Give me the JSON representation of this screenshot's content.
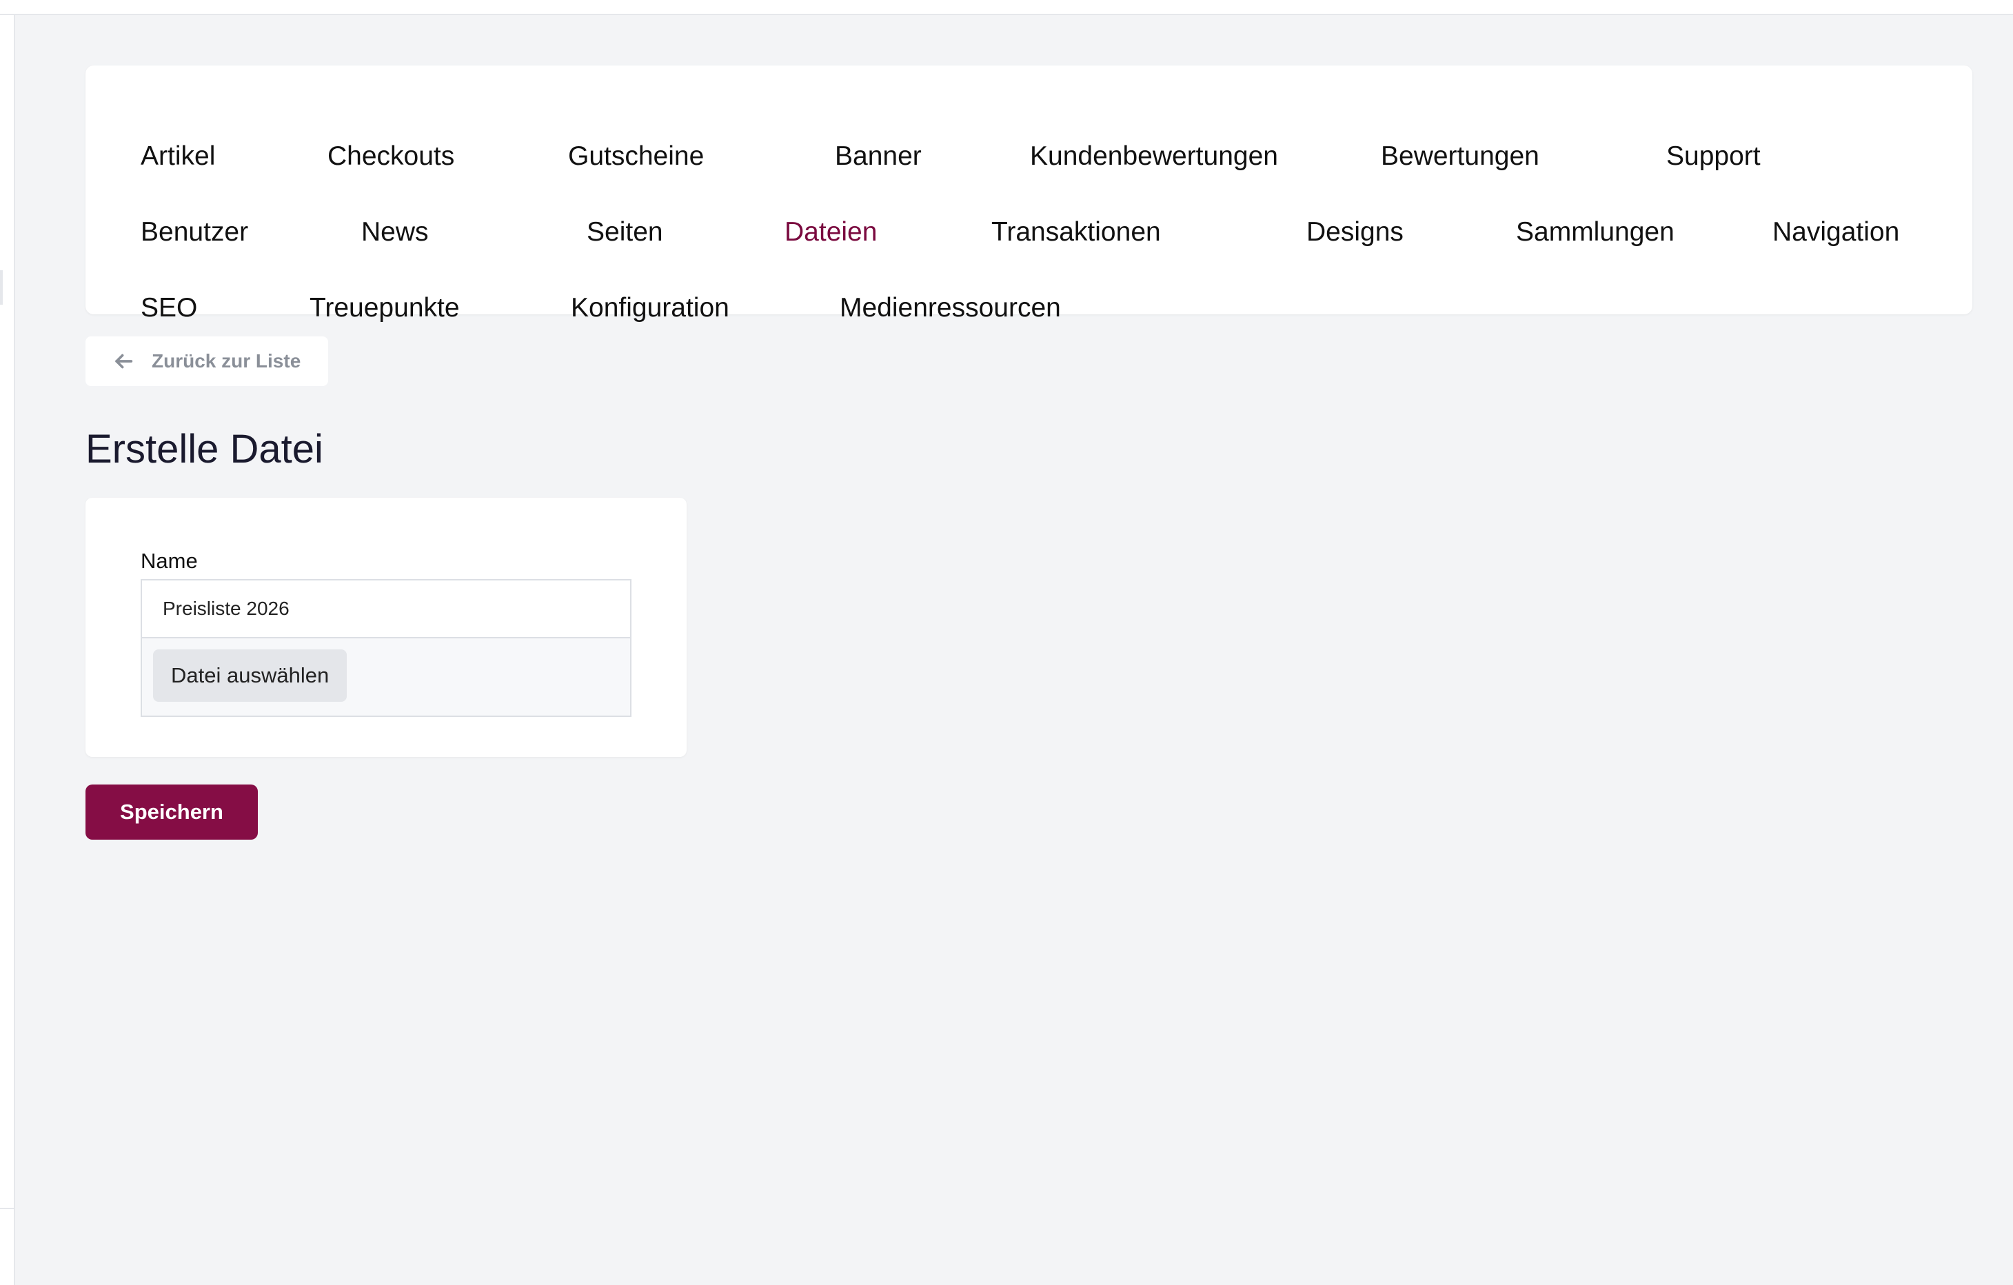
{
  "colors": {
    "accent": "#850d45",
    "active_nav": "#7a0a3f",
    "background": "#f3f4f6",
    "card": "#ffffff"
  },
  "nav": {
    "rows": [
      [
        {
          "label": "Artikel",
          "active": false
        },
        {
          "label": "Checkouts",
          "active": false
        },
        {
          "label": "Gutscheine",
          "active": false
        },
        {
          "label": "Banner",
          "active": false
        },
        {
          "label": "Kundenbewertungen",
          "active": false
        },
        {
          "label": "Bewertungen",
          "active": false
        },
        {
          "label": "Support",
          "active": false
        }
      ],
      [
        {
          "label": "Benutzer",
          "active": false
        },
        {
          "label": "News",
          "active": false
        },
        {
          "label": "Seiten",
          "active": false
        },
        {
          "label": "Dateien",
          "active": true
        },
        {
          "label": "Transaktionen",
          "active": false
        },
        {
          "label": "Designs",
          "active": false
        },
        {
          "label": "Sammlungen",
          "active": false
        },
        {
          "label": "Navigation",
          "active": false
        }
      ],
      [
        {
          "label": "SEO",
          "active": false
        },
        {
          "label": "Treuepunkte",
          "active": false
        },
        {
          "label": "Konfiguration",
          "active": false
        },
        {
          "label": "Medienressourcen",
          "active": false
        }
      ]
    ]
  },
  "back_button": {
    "icon": "arrow-left-icon",
    "label": "Zurück zur Liste"
  },
  "page": {
    "title": "Erstelle Datei"
  },
  "form": {
    "name_label": "Name",
    "name_value": "Preisliste 2026",
    "file_button_label": "Datei auswählen"
  },
  "save_button": {
    "label": "Speichern"
  }
}
